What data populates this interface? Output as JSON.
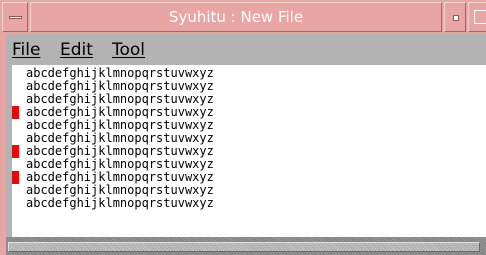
{
  "window": {
    "title": "Syuhitu : New File"
  },
  "menubar": {
    "items": [
      {
        "key": "F",
        "rest": "ile"
      },
      {
        "key": "E",
        "rest": "dit"
      },
      {
        "key": "T",
        "rest": "ool"
      }
    ]
  },
  "editor": {
    "lines": [
      "abcdefghijklmnopqrstuvwxyz",
      "abcdefghijklmnopqrstuvwxyz",
      "abcdefghijklmnopqrstuvwxyz",
      "abcdefghijklmnopqrstuvwxyz",
      "abcdefghijklmnopqrstuvwxyz",
      "abcdefghijklmnopqrstuvwxyz",
      "abcdefghijklmnopqrstuvwxyz",
      "abcdefghijklmnopqrstuvwxyz",
      "abcdefghijklmnopqrstuvwxyz",
      "abcdefghijklmnopqrstuvwxyz",
      "abcdefghijklmnopqrstuvwxyz"
    ],
    "marked_lines": [
      3,
      6,
      8
    ],
    "marker_color": "#e20a0a"
  },
  "colors": {
    "title_bar": "#e7a6a4",
    "window_bg": "#b3b3b3"
  }
}
